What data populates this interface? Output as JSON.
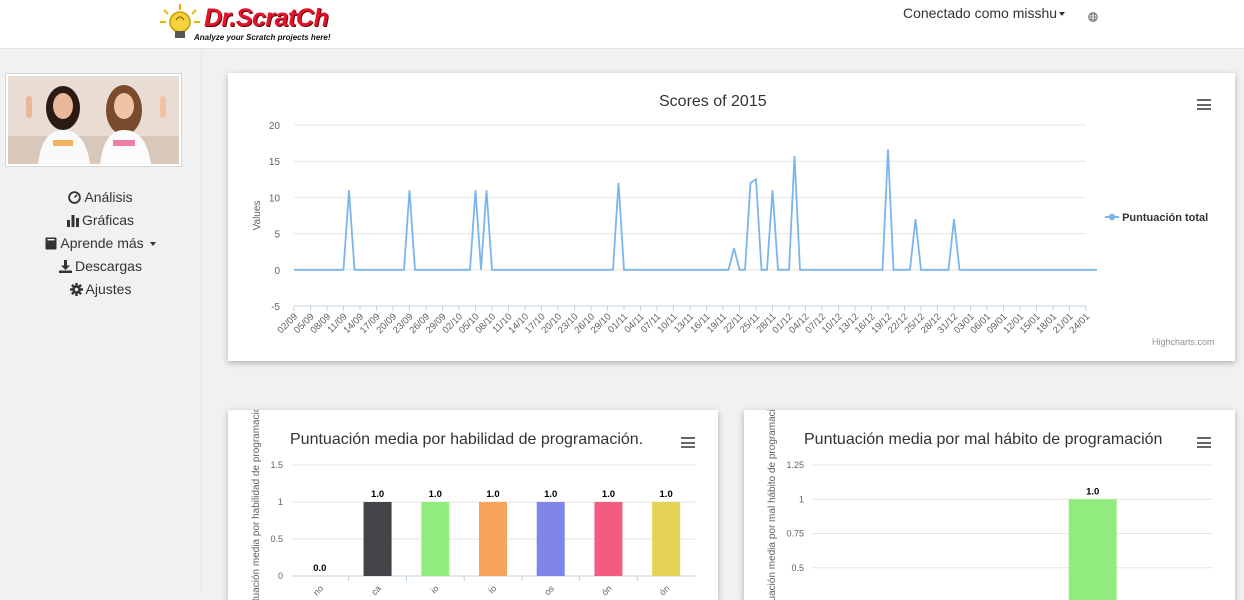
{
  "header": {
    "logo_text": "Dr.ScratCh",
    "logo_tagline": "Analyze your Scratch projects here!",
    "user_label": "Conectado como misshu"
  },
  "sidebar": {
    "items": [
      {
        "label": "Análisis",
        "icon": "dashboard-icon"
      },
      {
        "label": "Gráficas",
        "icon": "bar-chart-icon"
      },
      {
        "label": "Aprende más",
        "icon": "book-icon"
      },
      {
        "label": "Descargas",
        "icon": "download-icon"
      },
      {
        "label": "Ajustes",
        "icon": "gear-icon"
      }
    ]
  },
  "charts": {
    "credits": "Highcharts.com"
  },
  "colors": {
    "series_line": "#7cb5ec",
    "accent_red": "#e2142d"
  },
  "chart_data": [
    {
      "type": "line",
      "title": "Scores of 2015",
      "ylabel": "Values",
      "ylim": [
        -5,
        20
      ],
      "yticks": [
        -5,
        0,
        5,
        10,
        15,
        20
      ],
      "grid": true,
      "legend": "right",
      "x_labels": [
        "02/09",
        "05/09",
        "08/09",
        "11/09",
        "14/09",
        "17/09",
        "20/09",
        "23/09",
        "26/09",
        "29/09",
        "02/10",
        "05/10",
        "08/10",
        "11/10",
        "14/10",
        "17/10",
        "20/10",
        "23/10",
        "26/10",
        "29/10",
        "01/11",
        "04/11",
        "07/11",
        "10/11",
        "13/11",
        "16/11",
        "19/11",
        "22/11",
        "25/11",
        "28/11",
        "01/12",
        "04/12",
        "07/12",
        "10/12",
        "13/12",
        "16/12",
        "19/12",
        "22/12",
        "25/12",
        "28/12",
        "31/12",
        "03/01",
        "06/01",
        "09/01",
        "12/01",
        "15/01",
        "18/01",
        "21/01",
        "24/01"
      ],
      "series": [
        {
          "name": "Puntuación total",
          "color": "#7cb5ec",
          "points": [
            [
              0,
              0
            ],
            [
              9,
              0
            ],
            [
              10,
              11
            ],
            [
              11,
              0
            ],
            [
              20,
              0
            ],
            [
              21,
              11
            ],
            [
              22,
              0
            ],
            [
              32,
              0
            ],
            [
              33,
              11
            ],
            [
              34,
              0
            ],
            [
              35,
              11
            ],
            [
              36,
              0
            ],
            [
              58,
              0
            ],
            [
              59,
              12
            ],
            [
              60,
              0
            ],
            [
              79,
              0
            ],
            [
              80,
              3
            ],
            [
              81,
              0
            ],
            [
              82,
              0
            ],
            [
              83,
              12
            ],
            [
              84,
              12.5
            ],
            [
              85,
              0
            ],
            [
              86,
              0
            ],
            [
              87,
              11
            ],
            [
              88,
              0
            ],
            [
              90,
              0
            ],
            [
              91,
              15.7
            ],
            [
              92,
              0
            ],
            [
              107,
              0
            ],
            [
              108,
              16.6
            ],
            [
              109,
              0
            ],
            [
              112,
              0
            ],
            [
              113,
              7
            ],
            [
              114,
              0
            ],
            [
              119,
              0
            ],
            [
              120,
              7
            ],
            [
              121,
              0
            ],
            [
              146,
              0
            ]
          ]
        }
      ]
    },
    {
      "type": "bar",
      "title": "Puntuación media por habilidad de programación.",
      "ylabel": "Puntuación media por habilidad de programación",
      "ylim": [
        0,
        1.5
      ],
      "yticks": [
        "0",
        "0.5",
        "1",
        "1.5"
      ],
      "categories": [
        "no",
        "ca",
        "io",
        "io",
        "os",
        "ón",
        "ón"
      ],
      "values": [
        0.0,
        1.0,
        1.0,
        1.0,
        1.0,
        1.0,
        1.0
      ],
      "value_labels": [
        "0.0",
        "1.0",
        "1.0",
        "1.0",
        "1.0",
        "1.0",
        "1.0"
      ],
      "colors": [
        "#7cb5ec",
        "#434348",
        "#90ed7d",
        "#f7a35c",
        "#8085e9",
        "#f15c80",
        "#e4d354"
      ]
    },
    {
      "type": "bar",
      "title": "Puntuación media por mal hábito de programación",
      "ylabel": "Puntuación media por mal hábito de programación",
      "ylim": [
        0.25,
        1.25
      ],
      "yticks": [
        "0.5",
        "0.75",
        "1",
        "1.25"
      ],
      "categories": [],
      "values": [
        1.0
      ],
      "value_labels": [
        "1.0"
      ],
      "colors": [
        "#90ed7d"
      ]
    }
  ]
}
